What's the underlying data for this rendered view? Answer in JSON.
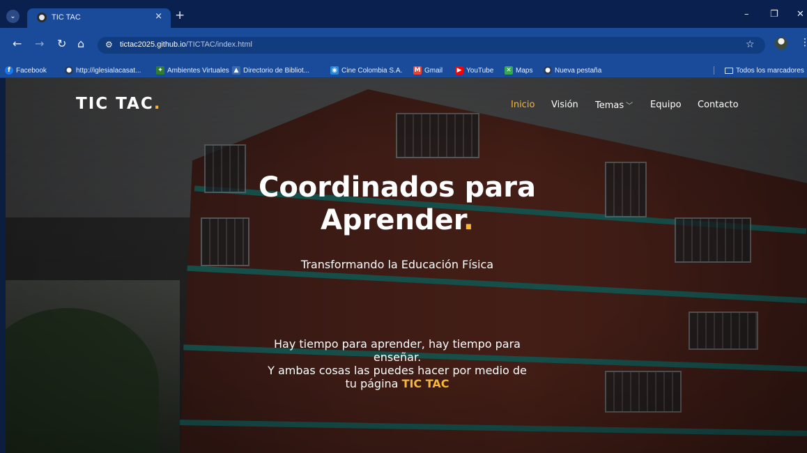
{
  "browser": {
    "tab_title": "TIC TAC",
    "tab_close": "×",
    "new_tab": "+",
    "window_controls": {
      "minimize": "–",
      "restore": "❐",
      "close": "✕"
    },
    "url_host": "tictac2025.github.io",
    "url_path": "/TICTAC/index.html",
    "icons": {
      "back": "back-arrow-icon",
      "forward": "forward-arrow-icon",
      "reload": "reload-icon",
      "home": "home-icon",
      "star": "star-icon",
      "menu": "kebab-menu-icon"
    }
  },
  "bookmarks": [
    {
      "label": "Facebook",
      "icon": "facebook-icon",
      "color": "#1877f2",
      "glyph": "f"
    },
    {
      "label": "http://iglesialacasat...",
      "icon": "globe-icon",
      "color": "#2a3a55",
      "glyph": "●"
    },
    {
      "label": "Ambientes Virtuales",
      "icon": "ambientes-icon",
      "color": "#2e7d32",
      "glyph": "✦"
    },
    {
      "label": "Directorio de Bibliot...",
      "icon": "library-icon",
      "color": "#3a6aa8",
      "glyph": "▲"
    },
    {
      "label": "Cine Colombia S.A.",
      "icon": "cine-colombia-icon",
      "color": "#2a86d6",
      "glyph": "◉"
    },
    {
      "label": "Gmail",
      "icon": "gmail-icon",
      "color": "#ea4335",
      "glyph": "M"
    },
    {
      "label": "YouTube",
      "icon": "youtube-icon",
      "color": "#ff0000",
      "glyph": "▶"
    },
    {
      "label": "Maps",
      "icon": "maps-icon",
      "color": "#34a853",
      "glyph": "✕"
    },
    {
      "label": "Nueva pestaña",
      "icon": "globe-icon",
      "color": "#2a3a55",
      "glyph": "●"
    }
  ],
  "all_bookmarks_label": "Todos los marcadores",
  "site": {
    "logo": {
      "text": "TIC TAC",
      "dot": "."
    },
    "nav": [
      {
        "label": "Inicio",
        "active": true
      },
      {
        "label": "Visión",
        "active": false
      },
      {
        "label": "Temas",
        "active": false,
        "dropdown": true
      },
      {
        "label": "Equipo",
        "active": false
      },
      {
        "label": "Contacto",
        "active": false
      }
    ],
    "hero": {
      "title_line1": "Coordinados para",
      "title_line2": "Aprender",
      "title_dot": ".",
      "subtitle": "Transformando la Educación Física",
      "body_line1": "Hay tiempo para aprender, hay tiempo para",
      "body_line2": "enseñar.",
      "body_line3": "Y ambas cosas las puedes hacer por medio de",
      "body_line4_prefix": "tu página",
      "body_brand": "TIC TAC"
    },
    "accent_color": "#f7b733"
  }
}
